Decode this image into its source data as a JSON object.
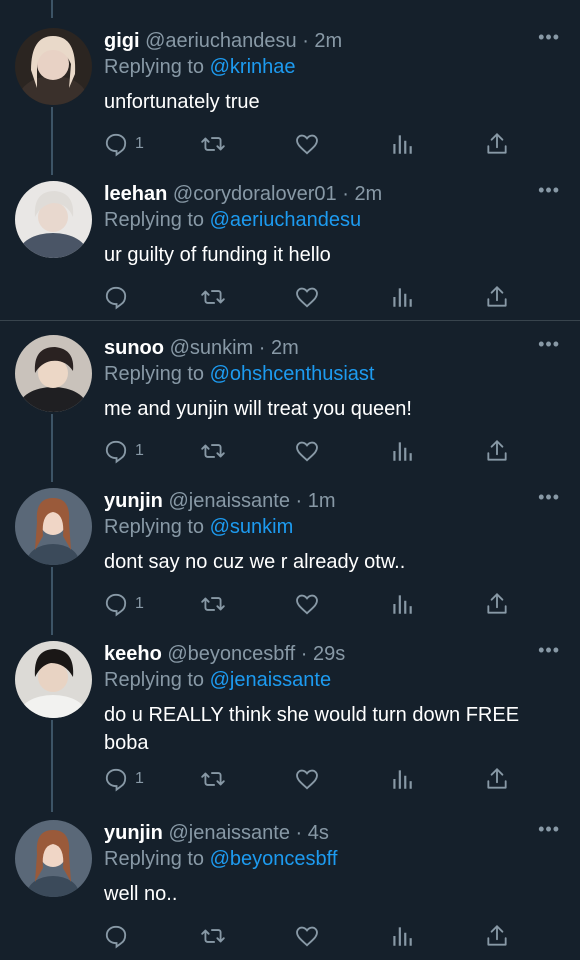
{
  "ui": {
    "reply_prefix": "Replying to",
    "more_label": "•••",
    "separator": "·",
    "accent_color": "#1d9bf0",
    "background_color": "#15202b"
  },
  "tweets": [
    {
      "name": "gigi",
      "handle": "@aeriuchandesu",
      "time": "2m",
      "reply_to": "@krinhae",
      "text": "unfortunately true",
      "reply_count": "1",
      "avatar_icon": "avatar-blonde-hair"
    },
    {
      "name": "leehan",
      "handle": "@corydoralover01",
      "time": "2m",
      "reply_to": "@aeriuchandesu",
      "text": "ur guilty of funding it hello",
      "reply_count": "",
      "avatar_icon": "avatar-light-hair"
    },
    {
      "name": "sunoo",
      "handle": "@sunkim",
      "time": "2m",
      "reply_to": "@ohshcenthusiast",
      "text": "me and yunjin will treat you queen!",
      "reply_count": "1",
      "avatar_icon": "avatar-dark-hair"
    },
    {
      "name": "yunjin",
      "handle": "@jenaissante",
      "time": "1m",
      "reply_to": "@sunkim",
      "text": "dont say no cuz we r already otw..",
      "reply_count": "1",
      "avatar_icon": "avatar-auburn-hair"
    },
    {
      "name": "keeho",
      "handle": "@beyoncesbff",
      "time": "29s",
      "reply_to": "@jenaissante",
      "text": "do u REALLY think she would turn down FREE boba",
      "reply_count": "1",
      "avatar_icon": "avatar-black-hair"
    },
    {
      "name": "yunjin",
      "handle": "@jenaissante",
      "time": "4s",
      "reply_to": "@beyoncesbff",
      "text": "well no..",
      "reply_count": "",
      "avatar_icon": "avatar-auburn-hair"
    }
  ]
}
